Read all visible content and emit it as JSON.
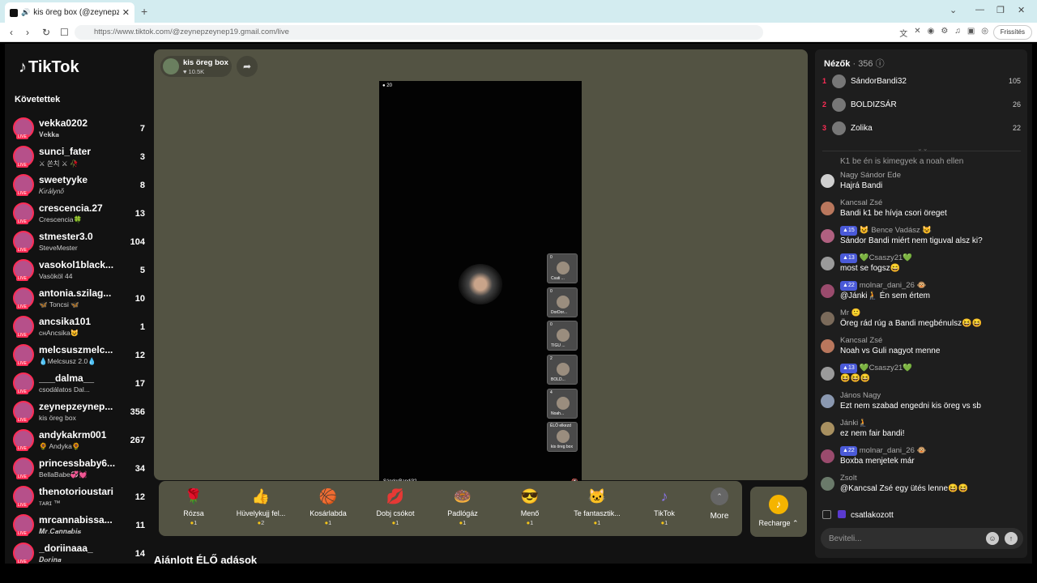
{
  "browser": {
    "tab_title": "kis öreg box (@zeynepzeyne",
    "url": "https://www.tiktok.com/@zeynepzeynep19.gmail.com/live",
    "update_label": "Frissítés"
  },
  "sidebar": {
    "logo": "TikTok",
    "following_heading": "Követettek",
    "live_badge": "LIVE",
    "items": [
      {
        "name": "vekka0202",
        "sub": "𝐕𝐞𝐤𝐤𝐚",
        "count": "7"
      },
      {
        "name": "sunci_fater",
        "sub": "⚔ 쏜치 ⚔ 🥀",
        "count": "3"
      },
      {
        "name": "sweetyyke",
        "sub": "𝐾𝑖𝑟𝑎́𝑙𝑦𝑛𝑜̋",
        "count": "8"
      },
      {
        "name": "crescencia.27",
        "sub": "Crescencia🍀",
        "count": "13"
      },
      {
        "name": "stmester3.0",
        "sub": "SteveMester",
        "count": "104"
      },
      {
        "name": "vasokol1black...",
        "sub": "Vasököl 44",
        "count": "5"
      },
      {
        "name": "antonia.szilag...",
        "sub": "🦋 Toncsi 🦋",
        "count": "10"
      },
      {
        "name": "ancsika101",
        "sub": "ᴄʜAncsika😺",
        "count": "1"
      },
      {
        "name": "melcsuszmelc...",
        "sub": "💧Melcsusz 2.0💧",
        "count": "12"
      },
      {
        "name": "___dalma__",
        "sub": "csodálatos Dal...",
        "count": "17"
      },
      {
        "name": "zeynepzeynep...",
        "sub": "kis öreg box",
        "count": "356"
      },
      {
        "name": "andykakrm001",
        "sub": "🌻 Andyka🌻",
        "count": "267"
      },
      {
        "name": "princessbaby6...",
        "sub": "BellaBabe💞💓",
        "count": "34"
      },
      {
        "name": "thenotorioustari",
        "sub": "ᴛᴀʀɪ ™",
        "count": "12"
      },
      {
        "name": "mrcannabissa...",
        "sub": "𝑴𝒓.𝑪𝒂𝒏𝒏𝒂𝒃𝒊𝒔",
        "count": "11"
      },
      {
        "name": "_doriinaaa_",
        "sub": "𝑫𝒐𝒓𝒊𝒏𝒂",
        "count": "14"
      }
    ]
  },
  "stream": {
    "host_name": "kis öreg box",
    "host_likes": "10.5K",
    "viewer_badge": "20",
    "bottom_name": "SándorBandi32",
    "guests": [
      {
        "count": "0",
        "name": "Csati ..."
      },
      {
        "count": "0",
        "name": "DorDor..."
      },
      {
        "count": "0",
        "name": "TIGU ..."
      },
      {
        "count": "2",
        "name": "BOLD..."
      },
      {
        "count": "4",
        "name": "Noah..."
      },
      {
        "count": "ÉLŐ elkezd",
        "name": "kis öreg box"
      }
    ]
  },
  "gifts": [
    {
      "name": "Rózsa",
      "price": "1",
      "icon": "🌹"
    },
    {
      "name": "Hüvelykujj fel...",
      "price": "2",
      "icon": "👍"
    },
    {
      "name": "Kosárlabda",
      "price": "1",
      "icon": "🏀"
    },
    {
      "name": "Dobj csókot",
      "price": "1",
      "icon": "💋"
    },
    {
      "name": "Padlógáz",
      "price": "1",
      "icon": "🍩"
    },
    {
      "name": "Menő",
      "price": "1",
      "icon": "😎"
    },
    {
      "name": "Te fantasztik...",
      "price": "1",
      "icon": "🐱"
    },
    {
      "name": "TikTok",
      "price": "1",
      "icon": "♪"
    }
  ],
  "more_label": "More",
  "recharge_label": "Recharge ⌃",
  "recommended_heading": "Ajánlott ÉLŐ adások",
  "viewers": {
    "heading": "Nézők",
    "count": "· 356",
    "top": [
      {
        "rank": "1",
        "name": "SándorBandi32",
        "score": "105"
      },
      {
        "rank": "2",
        "name": "BOLDIZSÁR",
        "score": "26"
      },
      {
        "rank": "3",
        "name": "Zolika",
        "score": "22"
      }
    ]
  },
  "chat": {
    "partial": "K1 be én is kimegyek a noah ellen",
    "messages": [
      {
        "badge": "",
        "user": "Nagy Sándor Ede",
        "text": "Hajrá Bandi"
      },
      {
        "badge": "",
        "user": "Kancsal Zsé",
        "text": "Bandi k1 be hívja csori öreget"
      },
      {
        "badge": "15",
        "user": "😺 Bence Vadász 😺",
        "text": "Sándor Bandi miért nem tiguval alsz ki?"
      },
      {
        "badge": "13",
        "user": "💚Csaszy21💚",
        "text": "most se fogsz😄"
      },
      {
        "badge": "22",
        "user": "molnar_dani_26 🐵",
        "text": "@Jánki🧎 Én sem értem"
      },
      {
        "badge": "",
        "user": "Mr 🙂",
        "text": "Öreg rád rúg a Bandi megbénulsz😆😆"
      },
      {
        "badge": "",
        "user": "Kancsal Zsé",
        "text": "Noah vs Guli nagyot menne"
      },
      {
        "badge": "13",
        "user": "💚Csaszy21💚",
        "text": "😆😆😆"
      },
      {
        "badge": "",
        "user": "János Nagy",
        "text": "Ezt nem szabad engedni kis öreg vs sb"
      },
      {
        "badge": "",
        "user": "Jánki🧎",
        "text": "ez nem fair bandi!"
      },
      {
        "badge": "22",
        "user": "molnar_dani_26 🐵",
        "text": "Boxba menjetek már"
      },
      {
        "badge": "",
        "user": "Zsolt",
        "text": "@Kancsal Zsé egy ütés lenne😆😆"
      }
    ],
    "joined": "csatlakozott",
    "input_placeholder": "Beviteli..."
  }
}
